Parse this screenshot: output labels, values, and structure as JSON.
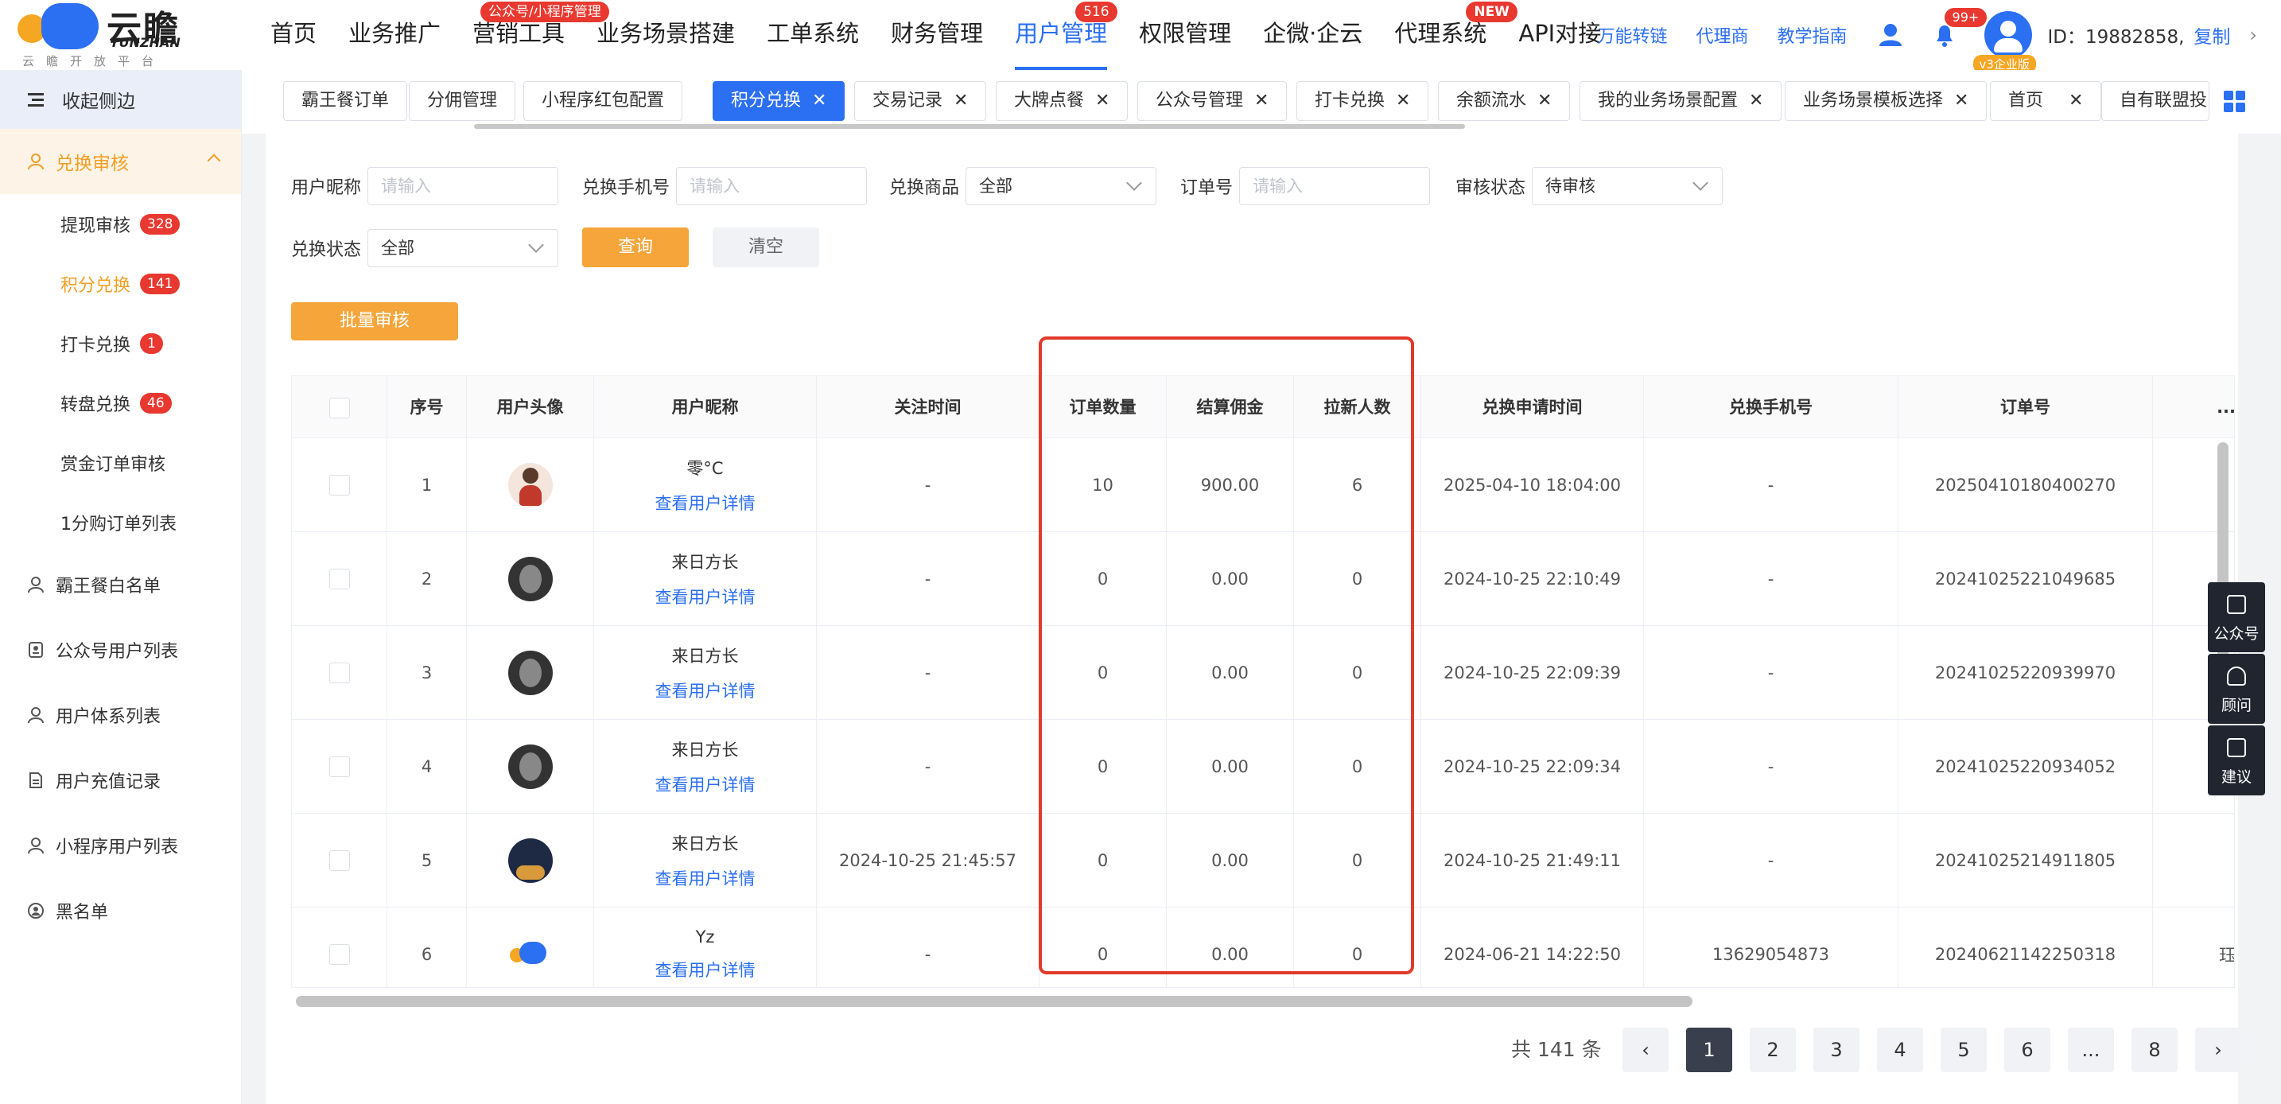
{
  "brand": {
    "name": "云瞻",
    "en": "YUNZHAN",
    "slogan": "云瞻开放平台"
  },
  "nav": {
    "items": [
      {
        "label": "首页"
      },
      {
        "label": "业务推广"
      },
      {
        "label": "营销工具",
        "badge": "公众号/小程序管理"
      },
      {
        "label": "业务场景搭建"
      },
      {
        "label": "工单系统"
      },
      {
        "label": "财务管理"
      },
      {
        "label": "用户管理",
        "badge": "516",
        "active": true
      },
      {
        "label": "权限管理"
      },
      {
        "label": "企微·企云"
      },
      {
        "label": "代理系统",
        "badge": "NEW"
      },
      {
        "label": "API对接"
      }
    ]
  },
  "header_right": {
    "links": [
      "万能转链",
      "代理商",
      "教学指南"
    ],
    "bell_badge": "99+",
    "version_tag": "v3企业版",
    "user_id": "ID：19882858,",
    "copy_label": "复制"
  },
  "sidebar": {
    "collapse_label": "收起侧边",
    "section": {
      "label": "兑换审核"
    },
    "sub_items": [
      {
        "label": "提现审核",
        "badge": "328"
      },
      {
        "label": "积分兑换",
        "badge": "141",
        "active": true
      },
      {
        "label": "打卡兑换",
        "badge": "1"
      },
      {
        "label": "转盘兑换",
        "badge": "46"
      },
      {
        "label": "赏金订单审核"
      },
      {
        "label": "1分购订单列表"
      }
    ],
    "items": [
      {
        "label": "霸王餐白名单",
        "icon": "user-icon"
      },
      {
        "label": "公众号用户列表",
        "icon": "id-card-icon"
      },
      {
        "label": "用户体系列表",
        "icon": "user-icon"
      },
      {
        "label": "用户充值记录",
        "icon": "document-icon"
      },
      {
        "label": "小程序用户列表",
        "icon": "user-icon"
      },
      {
        "label": "黑名单",
        "icon": "block-icon"
      }
    ]
  },
  "tabs": [
    {
      "label": "霸王餐订单"
    },
    {
      "label": "分佣管理"
    },
    {
      "label": "小程序红包配置"
    },
    {
      "label": "积分兑换",
      "active": true
    },
    {
      "label": "交易记录"
    },
    {
      "label": "大牌点餐"
    },
    {
      "label": "公众号管理"
    },
    {
      "label": "打卡兑换"
    },
    {
      "label": "余额流水"
    },
    {
      "label": "我的业务场景配置"
    },
    {
      "label": "业务场景模板选择"
    },
    {
      "label": "首页"
    },
    {
      "label": "自有联盟投"
    }
  ],
  "filters": {
    "nickname_label": "用户昵称",
    "nickname_placeholder": "请输入",
    "phone_label": "兑换手机号",
    "phone_placeholder": "请输入",
    "product_label": "兑换商品",
    "product_value": "全部",
    "order_label": "订单号",
    "order_placeholder": "请输入",
    "audit_label": "审核状态",
    "audit_value": "待审核",
    "exchange_label": "兑换状态",
    "exchange_value": "全部",
    "query_label": "查询",
    "clear_label": "清空",
    "batch_label": "批量审核"
  },
  "table": {
    "headers": [
      "序号",
      "用户头像",
      "用户昵称",
      "关注时间",
      "订单数量",
      "结算佣金",
      "拉新人数",
      "兑换申请时间",
      "兑换手机号",
      "订单号",
      "..."
    ],
    "detail_link": "查看用户详情",
    "rows": [
      {
        "no": "1",
        "nick": "零°C",
        "follow": "-",
        "orders": "10",
        "commission": "900.00",
        "invites": "6",
        "apply": "2025-04-10 18:04:00",
        "phone": "-",
        "order_no": "20250410180400270",
        "extra": ""
      },
      {
        "no": "2",
        "nick": "来日方长",
        "follow": "-",
        "orders": "0",
        "commission": "0.00",
        "invites": "0",
        "apply": "2024-10-25 22:10:49",
        "phone": "-",
        "order_no": "20241025221049685",
        "extra": ""
      },
      {
        "no": "3",
        "nick": "来日方长",
        "follow": "-",
        "orders": "0",
        "commission": "0.00",
        "invites": "0",
        "apply": "2024-10-25 22:09:39",
        "phone": "-",
        "order_no": "20241025220939970",
        "extra": ""
      },
      {
        "no": "4",
        "nick": "来日方长",
        "follow": "-",
        "orders": "0",
        "commission": "0.00",
        "invites": "0",
        "apply": "2024-10-25 22:09:34",
        "phone": "-",
        "order_no": "20241025220934052",
        "extra": ""
      },
      {
        "no": "5",
        "nick": "来日方长",
        "follow": "2024-10-25 21:45:57",
        "orders": "0",
        "commission": "0.00",
        "invites": "0",
        "apply": "2024-10-25 21:49:11",
        "phone": "-",
        "order_no": "20241025214911805",
        "extra": ""
      },
      {
        "no": "6",
        "nick": "Yz",
        "follow": "-",
        "orders": "0",
        "commission": "0.00",
        "invites": "0",
        "apply": "2024-06-21 14:22:50",
        "phone": "13629054873",
        "order_no": "20240621142250318",
        "extra": "珏"
      }
    ]
  },
  "pagination": {
    "total": "共 141 条",
    "pages": [
      "1",
      "2",
      "3",
      "4",
      "5",
      "6",
      "...",
      "8"
    ],
    "current": "1"
  },
  "float_buttons": [
    "公众号",
    "顾问",
    "建议"
  ],
  "colors": {
    "primary": "#2b6ff2",
    "accent": "#f5a53a",
    "badge": "#e8382f",
    "highlight_box": "#e03a2b"
  }
}
